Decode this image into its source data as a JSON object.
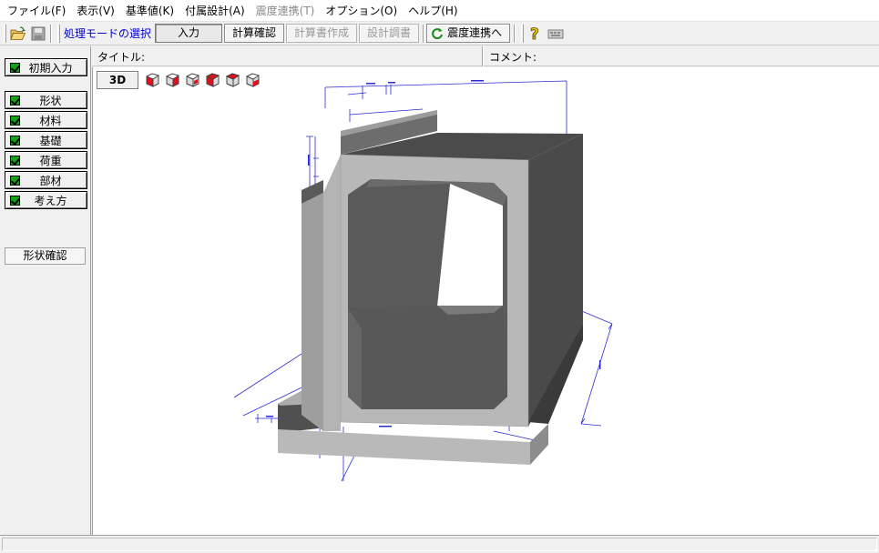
{
  "menu": [
    {
      "label": "ファイル(F)",
      "enabled": true
    },
    {
      "label": "表示(V)",
      "enabled": true
    },
    {
      "label": "基準値(K)",
      "enabled": true
    },
    {
      "label": "付属設計(A)",
      "enabled": true
    },
    {
      "label": "震度連携(T)",
      "enabled": false
    },
    {
      "label": "オプション(O)",
      "enabled": true
    },
    {
      "label": "ヘルプ(H)",
      "enabled": true
    }
  ],
  "toolbar": {
    "mode_label": "処理モードの選択",
    "input_btn": "入力",
    "calc_check_btn": "計算確認",
    "report_create_btn": "計算書作成",
    "design_doc_btn": "設計調書",
    "seismic_link_btn": "震度連携へ"
  },
  "nav": {
    "initial_input": "初期入力",
    "items": [
      "形状",
      "材料",
      "基礎",
      "荷重",
      "部材",
      "考え方"
    ],
    "shape_check": "形状確認"
  },
  "info": {
    "title_label": "タイトル:",
    "comment_label": "コメント:"
  },
  "view": {
    "btn_3d": "3D"
  },
  "colors": {
    "accent_blue": "#0000cc",
    "check_green": "#18a018",
    "cube_red": "#e0101c",
    "dim_blue": "#2b2bd6"
  }
}
